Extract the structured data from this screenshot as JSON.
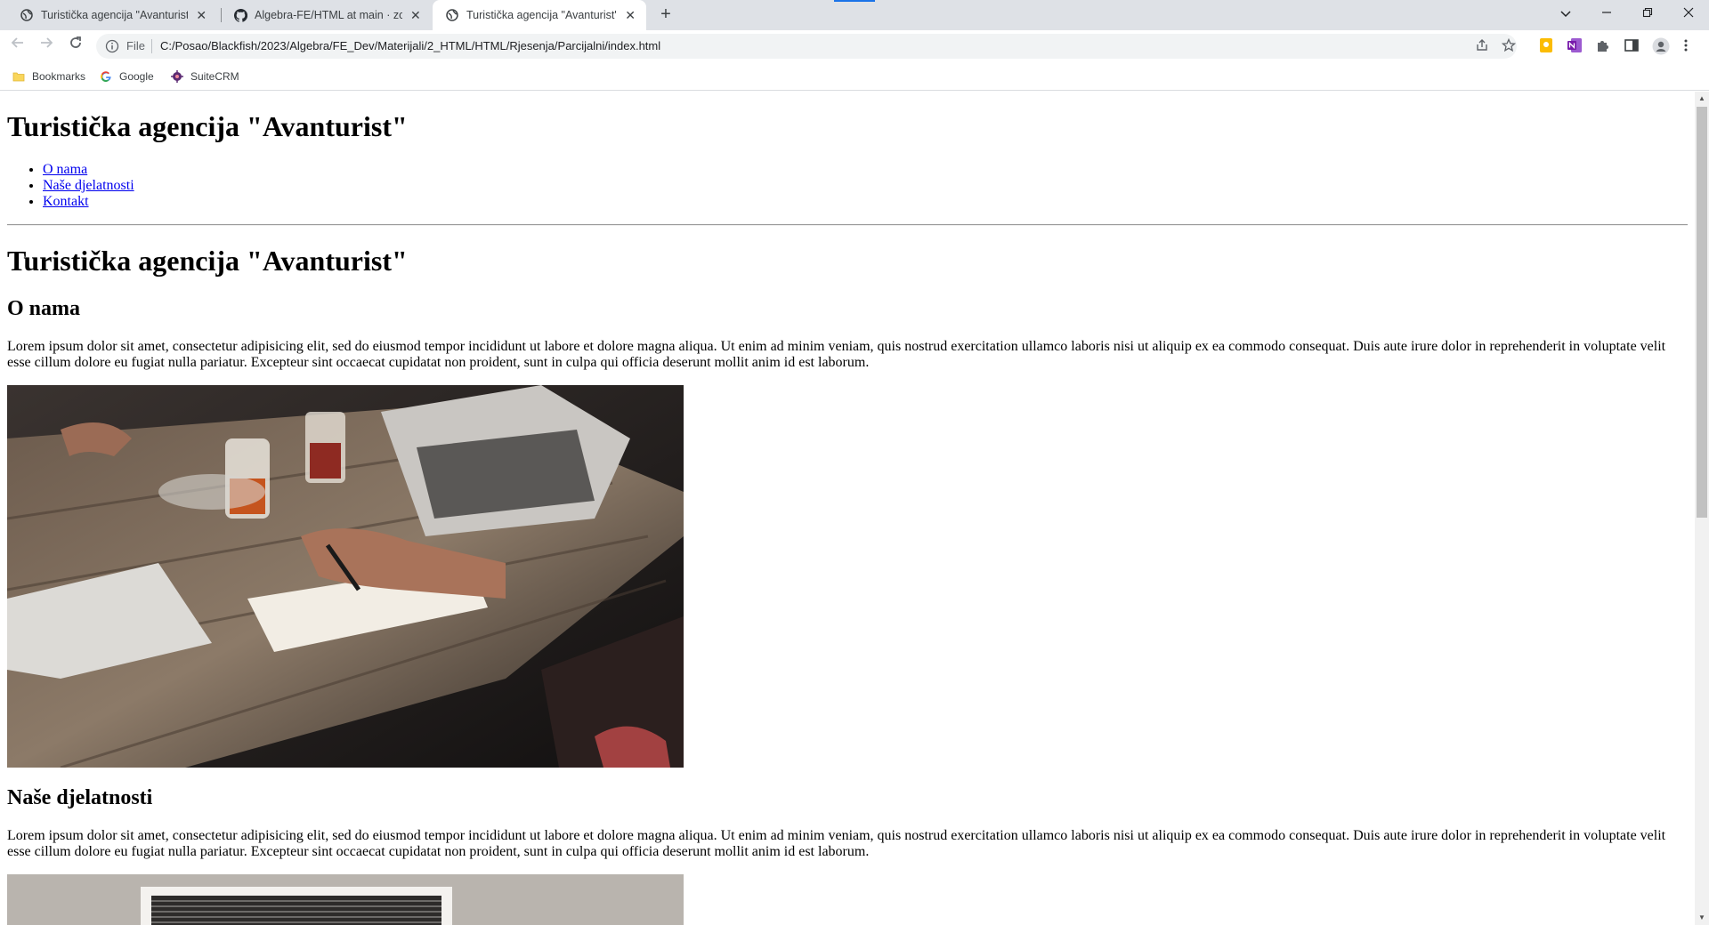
{
  "browser": {
    "tabs": [
      {
        "title": "Turistička agencija \"Avanturist\"",
        "active": false,
        "icon": "globe-icon"
      },
      {
        "title": "Algebra-FE/HTML at main · zorisl",
        "active": false,
        "icon": "github-icon"
      },
      {
        "title": "Turistička agencija \"Avanturist\"",
        "active": true,
        "icon": "globe-icon"
      }
    ],
    "new_tab_label": "+",
    "address": {
      "scheme_label": "File",
      "url": "C:/Posao/Blackfish/2023/Algebra/FE_Dev/Materijali/2_HTML/HTML/Rjesenja/Parcijalni/index.html"
    },
    "bookmarks": [
      {
        "label": "Bookmarks",
        "icon": "folder-icon"
      },
      {
        "label": "Google",
        "icon": "google-icon"
      },
      {
        "label": "SuiteCRM",
        "icon": "suitecrm-icon"
      }
    ]
  },
  "page": {
    "header_title": "Turistička agencija \"Avanturist\"",
    "nav": [
      "O nama",
      "Naše djelatnosti",
      "Kontakt"
    ],
    "main_title": "Turistička agencija \"Avanturist\"",
    "sections": [
      {
        "heading": "O nama",
        "text": "Lorem ipsum dolor sit amet, consectetur adipisicing elit, sed do eiusmod tempor incididunt ut labore et dolore magna aliqua. Ut enim ad minim veniam, quis nostrud exercitation ullamco laboris nisi ut aliquip ex ea commodo consequat. Duis aute irure dolor in reprehenderit in voluptate velit esse cillum dolore eu fugiat nulla pariatur. Excepteur sint occaecat cupidatat non proident, sunt in culpa qui officia deserunt mollit anim id est laborum."
      },
      {
        "heading": "Naše djelatnosti",
        "text": "Lorem ipsum dolor sit amet, consectetur adipisicing elit, sed do eiusmod tempor incididunt ut labore et dolore magna aliqua. Ut enim ad minim veniam, quis nostrud exercitation ullamco laboris nisi ut aliquip ex ea commodo consequat. Duis aute irure dolor in reprehenderit in voluptate velit esse cillum dolore eu fugiat nulla pariatur. Excepteur sint occaecat cupidatat non proident, sunt in culpa qui officia deserunt mollit anim id est laborum."
      }
    ]
  },
  "colors": {
    "tabbar_bg": "#dee1e6",
    "link": "#0000ee",
    "omnibox_bg": "#f1f3f4"
  }
}
